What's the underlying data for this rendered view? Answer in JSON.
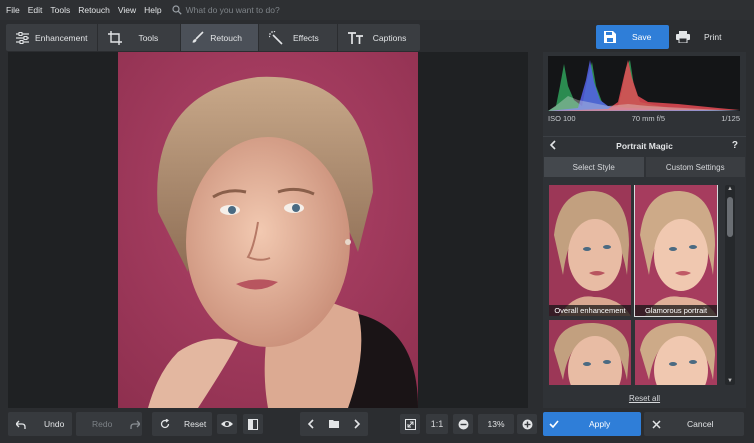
{
  "menu": {
    "items": [
      "File",
      "Edit",
      "Tools",
      "Retouch",
      "View",
      "Help"
    ],
    "search_placeholder": "What do you want to do?"
  },
  "toolbar": {
    "tabs": [
      {
        "label": "Enhancement",
        "icon": "sliders-icon"
      },
      {
        "label": "Tools",
        "icon": "crop-icon"
      },
      {
        "label": "Retouch",
        "icon": "brush-icon"
      },
      {
        "label": "Effects",
        "icon": "magic-wand-icon"
      },
      {
        "label": "Captions",
        "icon": "text-icon"
      }
    ],
    "active_tab": "Retouch",
    "save_label": "Save",
    "print_label": "Print"
  },
  "exif": {
    "iso": "ISO 100",
    "lens": "70 mm f/5",
    "shutter": "1/125"
  },
  "panel": {
    "title": "Portrait Magic",
    "help": "?",
    "tabs": [
      "Select Style",
      "Custom Settings"
    ],
    "active_tab": "Select Style",
    "styles": [
      {
        "label": "Overall enhancement"
      },
      {
        "label": "Glamorous portrait"
      },
      {
        "label": ""
      },
      {
        "label": ""
      }
    ],
    "selected_style": "Glamorous portrait",
    "reset_all": "Reset all"
  },
  "bottom": {
    "undo": "Undo",
    "redo": "Redo",
    "reset": "Reset",
    "ratio": "1:1",
    "zoom": "13%",
    "apply": "Apply",
    "cancel": "Cancel"
  },
  "colors": {
    "accent": "#2f7ed8",
    "backdrop": "#a3395b",
    "panel": "#2f3236"
  }
}
